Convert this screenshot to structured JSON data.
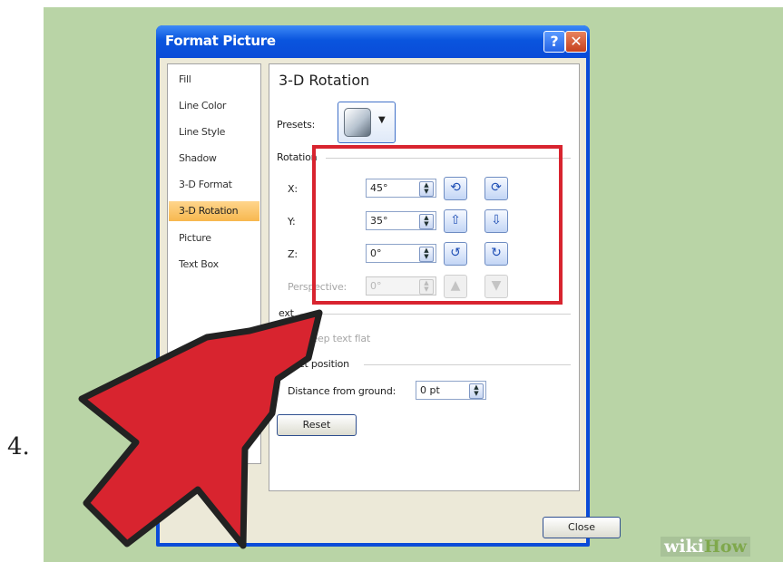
{
  "step_number": "4.",
  "dialog": {
    "title": "Format Picture",
    "help_button": "?",
    "close_x": "✕"
  },
  "nav": {
    "items": [
      "Fill",
      "Line Color",
      "Line Style",
      "Shadow",
      "3-D Format",
      "3-D Rotation",
      "Picture",
      "Text Box"
    ],
    "selected_index": 5
  },
  "main": {
    "heading": "3-D Rotation",
    "presets_label": "Presets:",
    "presets_dropdown_arrow": "▼",
    "rotation_section": "Rotation",
    "x_label": "X:",
    "x_value": "45°",
    "y_label": "Y:",
    "y_value": "35°",
    "z_label": "Z:",
    "z_value": "0°",
    "perspective_label": "Perspective:",
    "perspective_value": "0°",
    "text_section": "ext",
    "keep_text_flat": "Keep text flat",
    "object_position_section": "Object position",
    "distance_label": "Distance from ground:",
    "distance_value": "0 pt",
    "reset_button": "Reset",
    "close_button": "Close"
  },
  "icons": {
    "rotate_left": "⟲",
    "rotate_right": "⟳",
    "tilt_up": "⇧",
    "tilt_down": "⇩",
    "z_counter": "↺",
    "z_clockwise": "↻",
    "perspective_narrow": "▲",
    "perspective_widen": "▼",
    "spin_up": "▲",
    "spin_down": "▼"
  },
  "watermark": {
    "part1": "wiki",
    "part2": "How"
  },
  "colors": {
    "highlight_box": "#d8242f",
    "arrow": "#d8242f",
    "background": "#b9d4a6"
  }
}
